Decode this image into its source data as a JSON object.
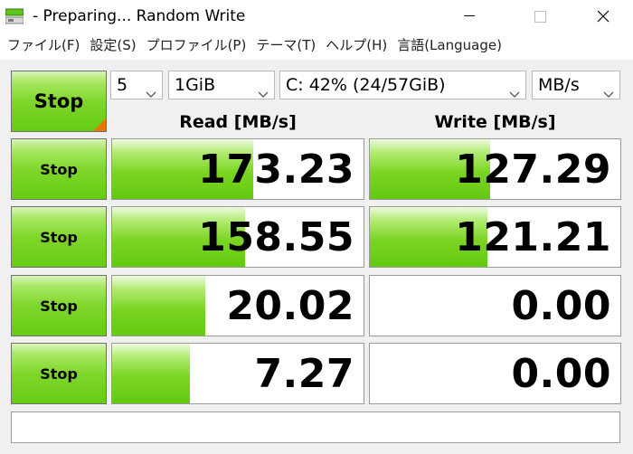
{
  "window": {
    "title": "- Preparing... Random Write",
    "controls": {
      "minimize_icon": "minimize-icon",
      "maximize_icon": "maximize-icon",
      "close_icon": "close-icon"
    }
  },
  "menu": {
    "items": [
      {
        "label": "ファイル(F)"
      },
      {
        "label": "設定(S)"
      },
      {
        "label": "プロファイル(P)"
      },
      {
        "label": "テーマ(T)"
      },
      {
        "label": "ヘルプ(H)"
      },
      {
        "label": "言語(Language)"
      }
    ]
  },
  "toolbar": {
    "all_button_label": "Stop",
    "count_value": "5",
    "size_value": "1GiB",
    "drive_value": "C: 42% (24/57GiB)",
    "unit_value": "MB/s"
  },
  "headers": {
    "read": "Read [MB/s]",
    "write": "Write [MB/s]"
  },
  "rows": [
    {
      "button_label": "Stop",
      "read": {
        "value": "173.23",
        "level": 0.56
      },
      "write": {
        "value": "127.29",
        "level": 0.48
      }
    },
    {
      "button_label": "Stop",
      "read": {
        "value": "158.55",
        "level": 0.53
      },
      "write": {
        "value": "121.21",
        "level": 0.47
      }
    },
    {
      "button_label": "Stop",
      "read": {
        "value": "20.02",
        "level": 0.37
      },
      "write": {
        "value": "0.00",
        "level": 0
      }
    },
    {
      "button_label": "Stop",
      "read": {
        "value": "7.27",
        "level": 0.31
      },
      "write": {
        "value": "0.00",
        "level": 0
      }
    }
  ],
  "comment": "",
  "colors": {
    "accent_green": "#66cc12",
    "corner_orange": "#e8740c"
  }
}
